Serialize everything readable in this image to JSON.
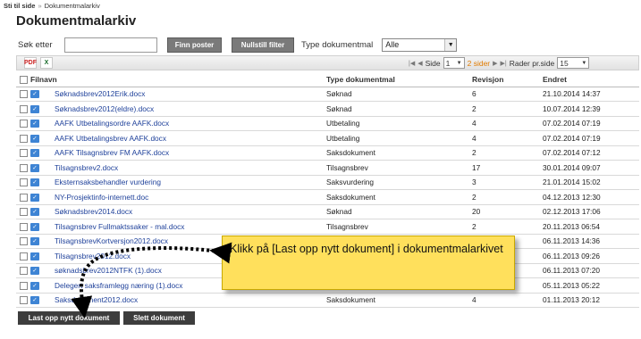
{
  "breadcrumb": {
    "skip": "Sti til side",
    "separator": "»",
    "current": "Dokumentmalarkiv"
  },
  "page": {
    "title": "Dokumentmalarkiv"
  },
  "search": {
    "label": "Søk etter",
    "value": "",
    "find_button": "Finn poster",
    "reset_button": "Nullstill filter",
    "type_label": "Type dokumentmal",
    "type_selected": "Alle"
  },
  "toolbar": {
    "pdf_icon": "pdf-export-icon",
    "excel_icon": "excel-export-icon",
    "page_label": "Side",
    "page_value": "1",
    "page_total": "2 sider",
    "rows_label": "Rader pr.side",
    "rows_value": "15"
  },
  "table": {
    "columns": [
      "Filnavn",
      "Type dokumentmal",
      "Revisjon",
      "Endret"
    ],
    "rows": [
      {
        "name": "Søknadsbrev2012Erik.docx",
        "type": "Søknad",
        "rev": "6",
        "changed": "21.10.2014 14:37"
      },
      {
        "name": "Søknadsbrev2012(eldre).docx",
        "type": "Søknad",
        "rev": "2",
        "changed": "10.07.2014 12:39"
      },
      {
        "name": "AAFK Utbetalingsordre AAFK.docx",
        "type": "Utbetaling",
        "rev": "4",
        "changed": "07.02.2014 07:19"
      },
      {
        "name": "AAFK Utbetalingsbrev AAFK.docx",
        "type": "Utbetaling",
        "rev": "4",
        "changed": "07.02.2014 07:19"
      },
      {
        "name": "AAFK Tilsagnsbrev FM AAFK.docx",
        "type": "Saksdokument",
        "rev": "2",
        "changed": "07.02.2014 07:12"
      },
      {
        "name": "Tilsagnsbrev2.docx",
        "type": "Tilsagnsbrev",
        "rev": "17",
        "changed": "30.01.2014 09:07"
      },
      {
        "name": "Eksternsaksbehandler vurdering",
        "type": "Saksvurdering",
        "rev": "3",
        "changed": "21.01.2014 15:02"
      },
      {
        "name": "NY-Prosjektinfo-internett.doc",
        "type": "Saksdokument",
        "rev": "2",
        "changed": "04.12.2013 12:30"
      },
      {
        "name": "Søknadsbrev2014.docx",
        "type": "Søknad",
        "rev": "20",
        "changed": "02.12.2013 17:06"
      },
      {
        "name": "Tilsagnsbrev Fullmaktssaker - mal.docx",
        "type": "Tilsagnsbrev",
        "rev": "2",
        "changed": "20.11.2013 06:54"
      },
      {
        "name": "TilsagnsbrevKortversjon2012.docx",
        "type": "",
        "rev": "",
        "changed": "06.11.2013 14:36"
      },
      {
        "name": "Tilsagnsbrev2012.docx",
        "type": "",
        "rev": "",
        "changed": "06.11.2013 09:26"
      },
      {
        "name": "søknadsbrev2012NTFK (1).docx",
        "type": "",
        "rev": "",
        "changed": "06.11.2013 07:20"
      },
      {
        "name": "Delegert saksframlegg næring (1).docx",
        "type": "Saksdokument",
        "rev": "3",
        "changed": "05.11.2013 05:22"
      },
      {
        "name": "Saksdokument2012.docx",
        "type": "Saksdokument",
        "rev": "4",
        "changed": "01.11.2013 20:12"
      }
    ]
  },
  "actions": {
    "upload": "Last opp nytt dokument",
    "delete": "Slett dokument"
  },
  "callout": {
    "text": "Klikk på [Last opp nytt dokument] i dokumentmalarkivet"
  },
  "colors": {
    "link": "#20429b",
    "callout": "#ffe05c",
    "pager_total": "#e07b00",
    "button_dark": "#3d3d3d",
    "button_gray": "#7a7a7a"
  }
}
